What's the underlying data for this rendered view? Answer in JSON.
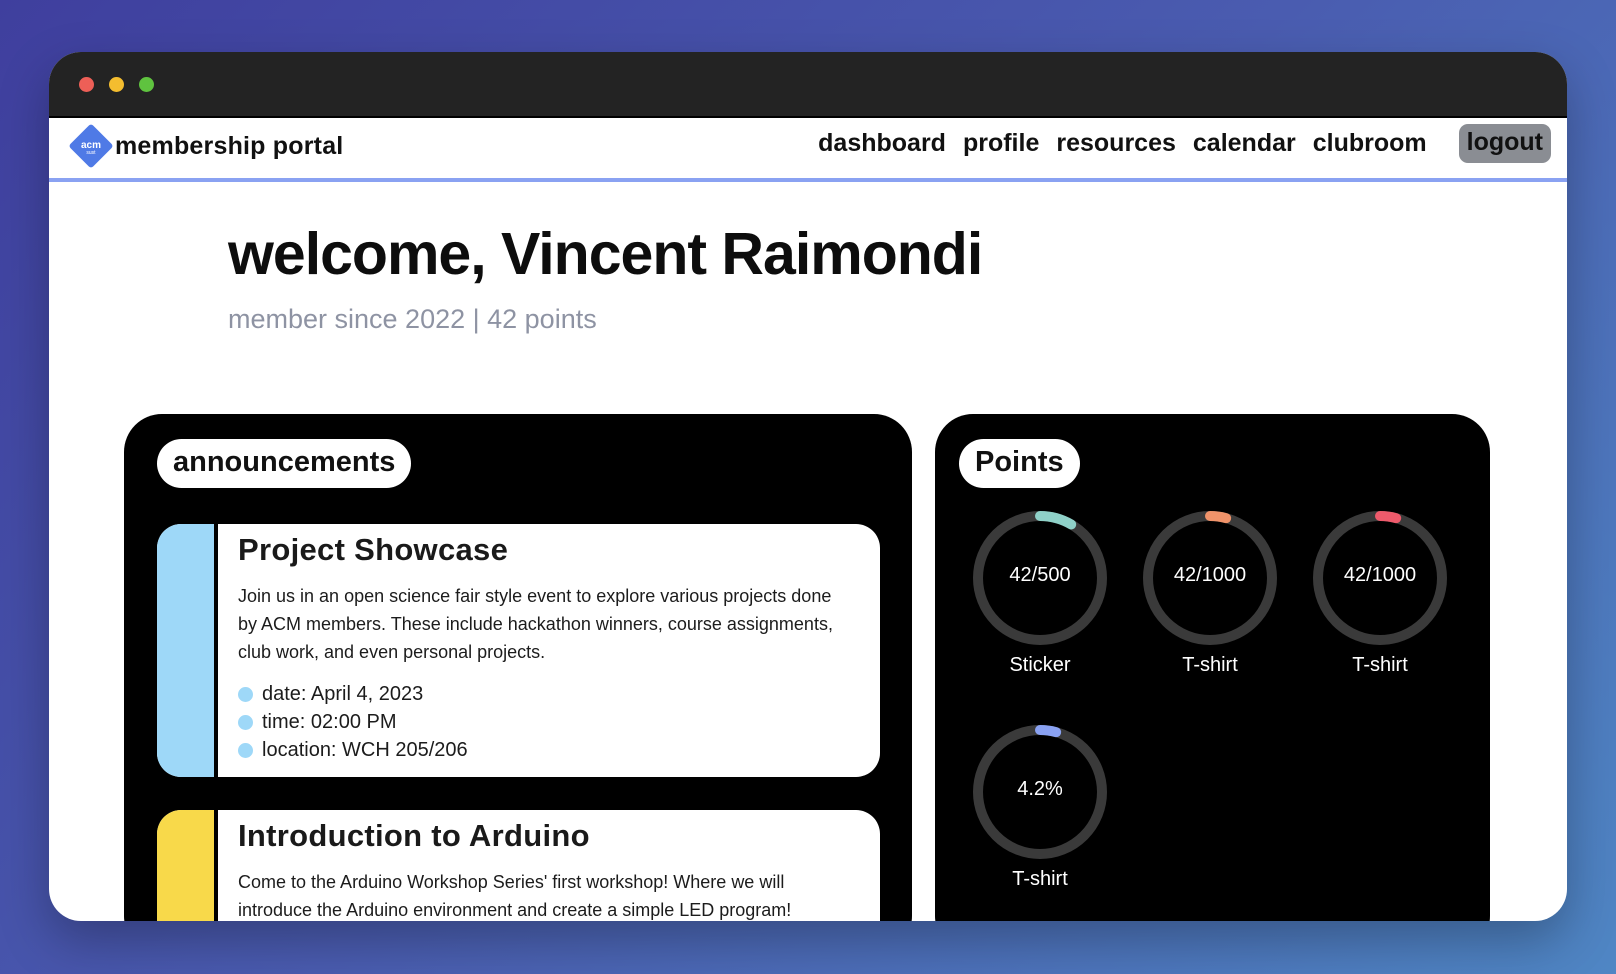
{
  "navbar": {
    "logo_text": "acm",
    "logo_sub": "sust",
    "brand": "membership portal",
    "links": [
      "dashboard",
      "profile",
      "resources",
      "calendar",
      "clubroom"
    ],
    "logout": "logout"
  },
  "welcome": {
    "title": "welcome, Vincent Raimondi",
    "subtitle": "member since 2022 | 42 points"
  },
  "announcements": {
    "heading": "announcements",
    "items": [
      {
        "title": "Project Showcase",
        "description": "Join us in an open science fair style event to explore various projects done by ACM members. These include hackathon winners, course assignments, club work, and even personal projects.",
        "details": [
          "date: April 4, 2023",
          "time: 02:00 PM",
          "location: WCH 205/206"
        ],
        "color": "#9ed8f8"
      },
      {
        "title": "Introduction to Arduino",
        "description": "Come to the Arduino Workshop Series' first workshop! Where we will introduce the Arduino environment and create a simple LED program!",
        "color": "#f8d94a"
      }
    ]
  },
  "points": {
    "heading": "Points",
    "gauges": [
      {
        "value_text": "42/500",
        "label": "Sticker",
        "fraction": 0.084,
        "color": "#8fd1c8"
      },
      {
        "value_text": "42/1000",
        "label": "T-shirt",
        "fraction": 0.042,
        "color": "#f0936a"
      },
      {
        "value_text": "42/1000",
        "label": "T-shirt",
        "fraction": 0.042,
        "color": "#ee5a6b"
      },
      {
        "value_text": "4.2%",
        "label": "T-shirt",
        "fraction": 0.042,
        "color": "#8aa2f2"
      }
    ]
  },
  "colors": {
    "accent": "#8aa2f2",
    "logo": "#4f7ae6",
    "track": "#3a3a3a"
  }
}
